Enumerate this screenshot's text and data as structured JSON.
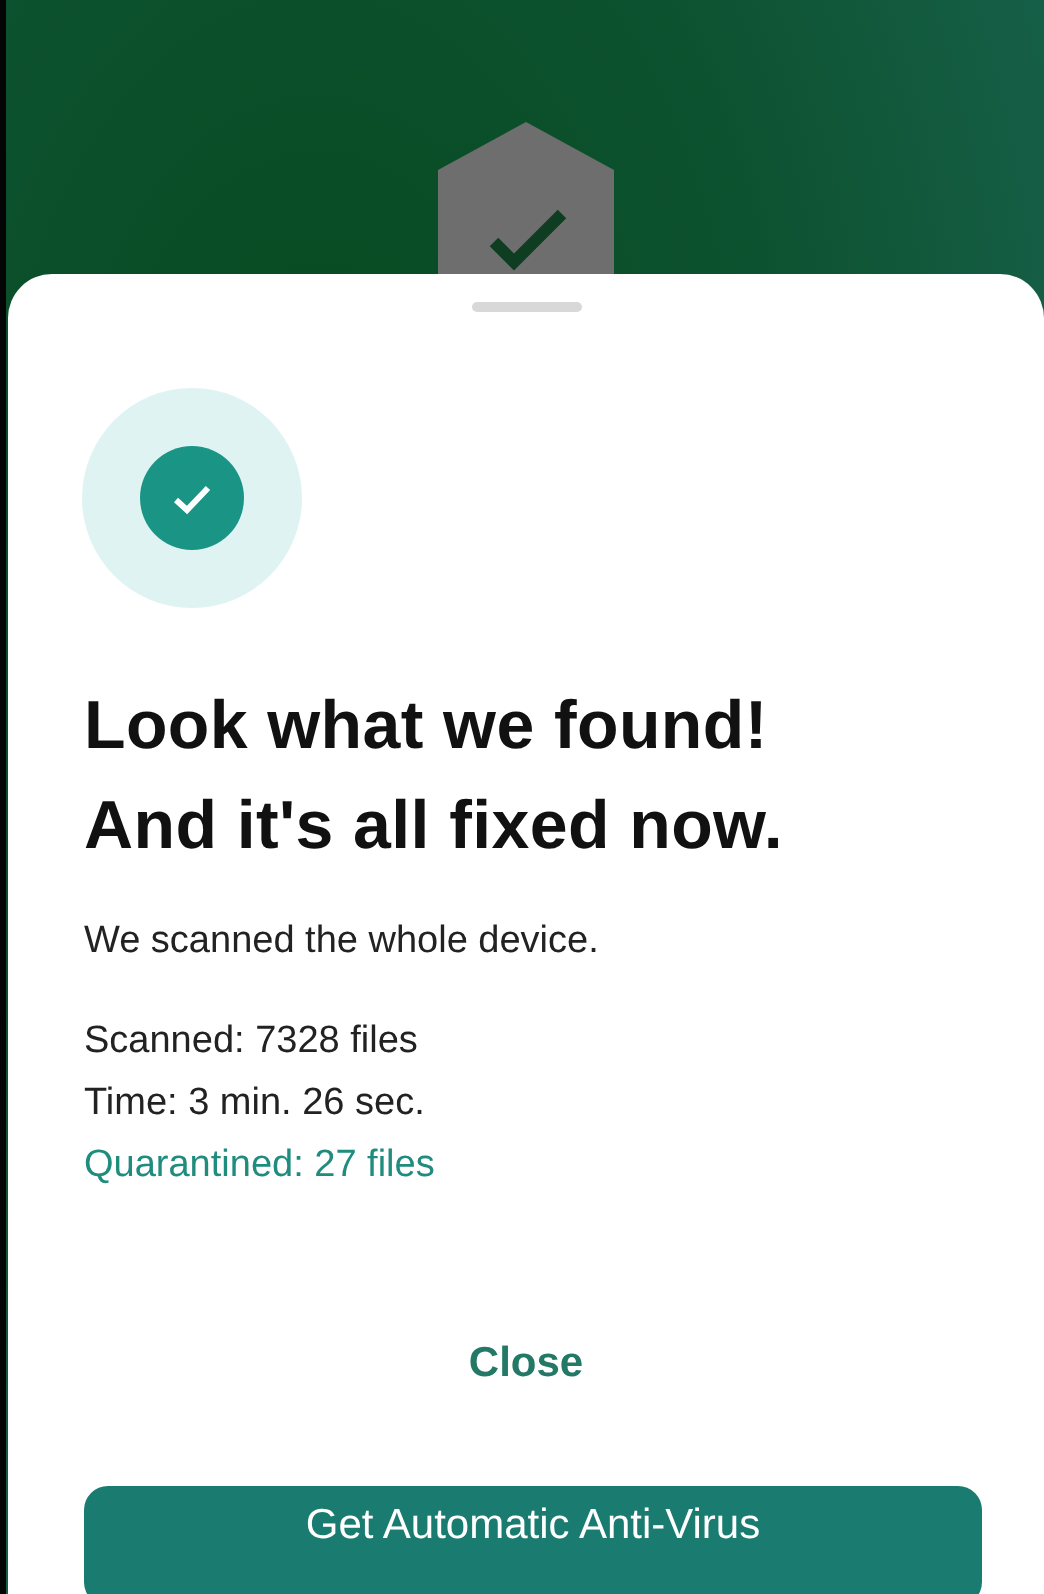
{
  "dialog": {
    "title_lines": [
      "Look what we found!",
      "And it's all fixed now."
    ],
    "message": "We scanned the whole device.",
    "stats": [
      {
        "kind": "plain",
        "text": "Scanned: 7328 files"
      },
      {
        "kind": "plain",
        "text": "Time: 3 min. 26 sec."
      },
      {
        "kind": "accent",
        "text": "Quarantined: 27 files"
      }
    ],
    "close_label": "Close",
    "primary_button": "Get Automatic Anti-Virus"
  }
}
